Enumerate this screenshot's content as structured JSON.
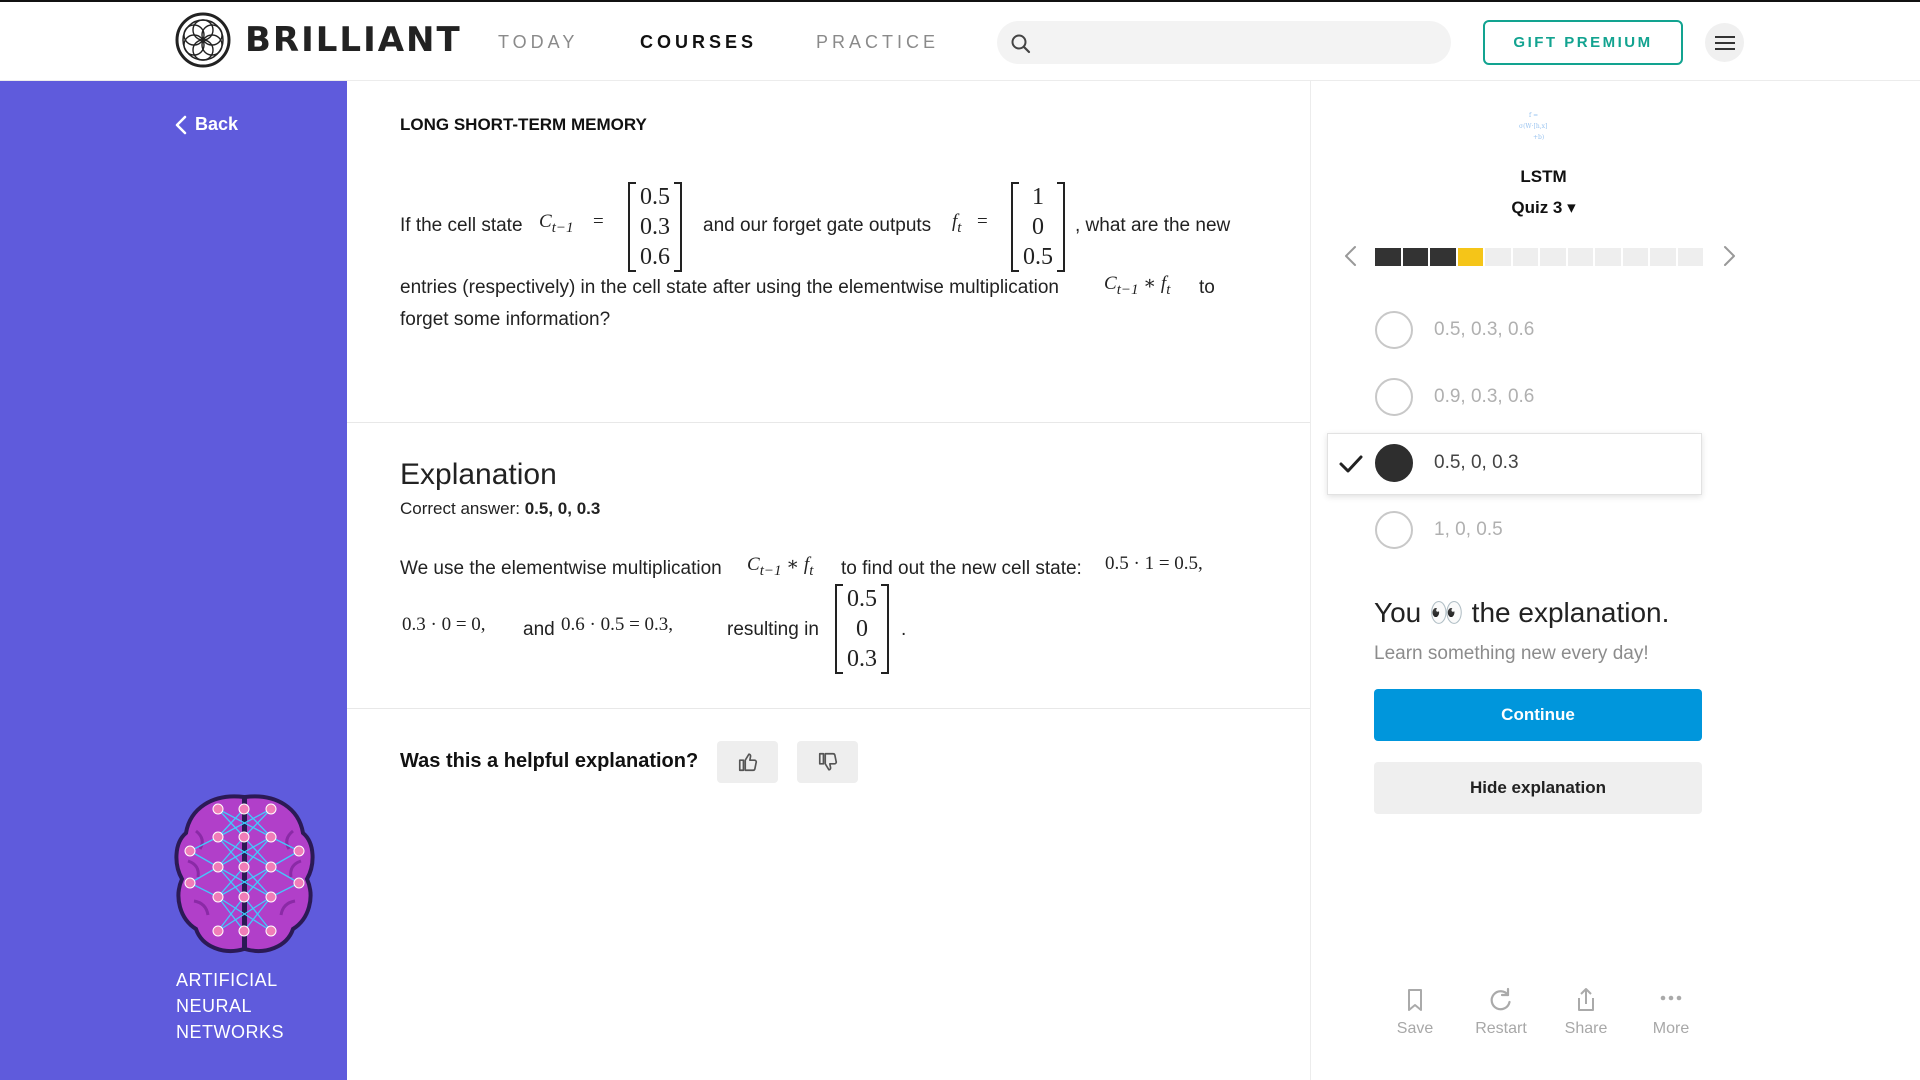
{
  "header": {
    "brand": "BRILLIANT",
    "nav": [
      {
        "label": "TODAY",
        "active": false
      },
      {
        "label": "COURSES",
        "active": true
      },
      {
        "label": "PRACTICE",
        "active": false
      }
    ],
    "search_placeholder": "",
    "gift_label": "GIFT PREMIUM",
    "menu_icon": "hamburger-icon"
  },
  "sidebar": {
    "back_label": "Back",
    "course_name_lines": [
      "ARTIFICIAL",
      "NEURAL",
      "NETWORKS"
    ],
    "bg_color": "#5f5bdc"
  },
  "main": {
    "section_title": "LONG SHORT-TERM MEMORY",
    "question": {
      "p1": "If the cell state",
      "var1": "C",
      "var1_sub": "t−1",
      "eq": "=",
      "matrix1": [
        "0.5",
        "0.3",
        "0.6"
      ],
      "p2": "and our forget gate outputs",
      "var2": "f",
      "var2_sub": "t",
      "matrix2": [
        "1",
        "0",
        "0.5"
      ],
      "p3": ", what are the new",
      "line2_a": "entries (respectively) in the cell state after using the elementwise multiplication",
      "line2_b": "to",
      "line3": "forget some information?"
    },
    "explanation": {
      "title": "Explanation",
      "correct_prefix": "Correct answer:",
      "correct_value": "0.5, 0, 0.3",
      "p1": "We use the elementwise multiplication",
      "p2": "to find out the new cell state:",
      "eq1": "0.5 · 1 = 0.5,",
      "eq2": "0.3 · 0 = 0,",
      "and": "and",
      "eq3": "0.6 · 0.5 = 0.3,",
      "resulting": "resulting in",
      "result_matrix": [
        "0.5",
        "0",
        "0.3"
      ],
      "period": "."
    },
    "feedback": {
      "question": "Was this a helpful explanation?",
      "up_icon": "thumbs-up-icon",
      "down_icon": "thumbs-down-icon"
    }
  },
  "panel": {
    "title": "LSTM",
    "quiz": "Quiz 3 ▾",
    "progress": {
      "total": 12,
      "completed": 3,
      "current": 4,
      "colors": {
        "done": "#333333",
        "current": "#f5c518",
        "todo": "#eeeeee"
      }
    },
    "options": [
      {
        "label": "0.5, 0.3, 0.6",
        "selected": false
      },
      {
        "label": "0.9, 0.3, 0.6",
        "selected": false
      },
      {
        "label": "0.5, 0, 0.3",
        "selected": true
      },
      {
        "label": "1, 0, 0.5",
        "selected": false
      }
    ],
    "headline": "You 👀 the explanation.",
    "sub": "Learn something new every day!",
    "continue_label": "Continue",
    "hide_label": "Hide explanation",
    "actions": [
      {
        "label": "Save",
        "icon": "bookmark-icon"
      },
      {
        "label": "Restart",
        "icon": "restart-icon"
      },
      {
        "label": "Share",
        "icon": "share-icon"
      },
      {
        "label": "More",
        "icon": "more-icon"
      }
    ],
    "accent": "#0096dc"
  }
}
